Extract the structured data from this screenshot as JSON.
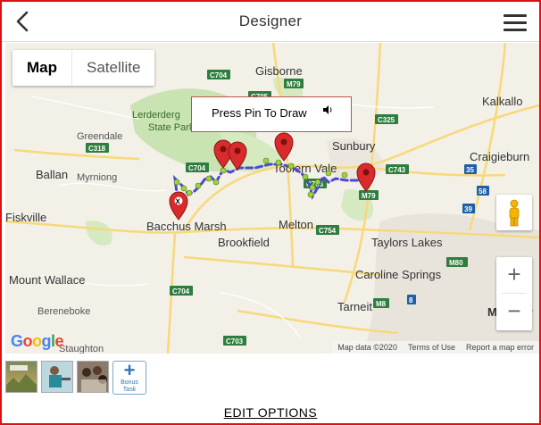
{
  "header": {
    "title": "Designer",
    "back_icon": "chevron-left-icon",
    "menu_icon": "hamburger-menu-icon"
  },
  "map": {
    "map_type_options": [
      "Map",
      "Satellite"
    ],
    "selected_map_type": "Map",
    "callout": {
      "text": "Press Pin To Draw",
      "icon": "speaker-icon"
    },
    "zoom": {
      "in_label": "+",
      "out_label": "−"
    },
    "logo": "Google",
    "attribution": [
      "Map data ©2020",
      "Terms of Use",
      "Report a map error"
    ],
    "places": {
      "gisborne": "Gisborne",
      "kalkallo": "Kalkallo",
      "lerderderg": "Lerderderg",
      "state_park": "State Park",
      "greendale": "Greendale",
      "sunbury": "Sunbury",
      "craigieburn": "Craigieburn",
      "ballan": "Ballan",
      "myrniong": "Myrniong",
      "toolern_vale": "Toolern Vale",
      "bacchus_marsh": "Bacchus Marsh",
      "fiskville": "Fiskville",
      "melton": "Melton",
      "brookfield": "Brookfield",
      "taylors_lakes": "Taylors Lakes",
      "caroline_springs": "Caroline Springs",
      "mount_wallace": "Mount Wallace",
      "bereneboke": "Bereneboke",
      "tarneit": "Tarneit",
      "melbourne": "Melbour",
      "staughton": "Staughton"
    },
    "road_labels": {
      "c704_top": "C704",
      "c705": "C705",
      "m79_top": "M79",
      "c325": "C325",
      "c318": "C318",
      "c704_mid": "C704",
      "c743": "C743",
      "m79_bottom": "M79",
      "c706": "C706",
      "c754": "C754",
      "m80": "M80",
      "m8": "M8",
      "c704_low": "C704",
      "c703": "C703",
      "r39": "39",
      "r58": "58",
      "r35": "35",
      "r8": "8"
    },
    "pins": [
      {
        "label": "X"
      },
      {},
      {},
      {},
      {}
    ],
    "route_color": "#4a4acc",
    "pin_color": "#d92b2b",
    "waypoint_color": "#9fd33a"
  },
  "toolbar": {
    "thumbnails": [
      "landscape-thumbnail",
      "person-thumbnail",
      "group-thumbnail"
    ],
    "bonus": {
      "plus": "+",
      "label_1": "Bonus",
      "label_2": "Task"
    }
  },
  "footer": {
    "edit_options": "EDIT OPTIONS"
  }
}
